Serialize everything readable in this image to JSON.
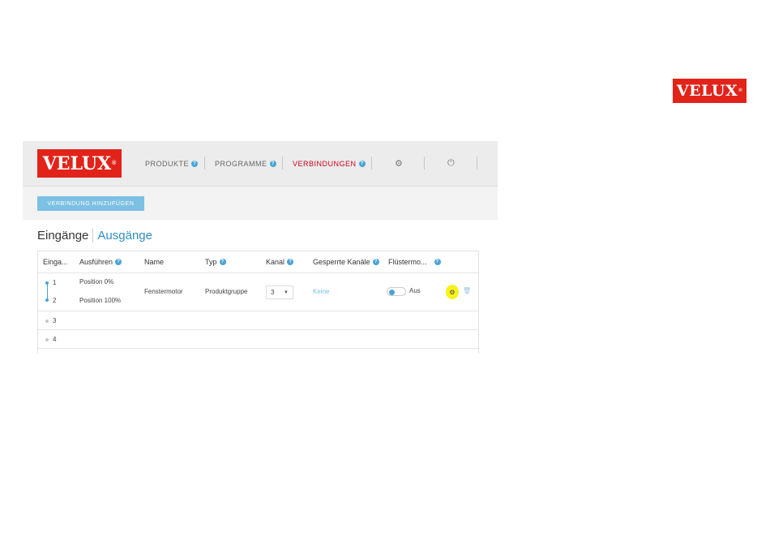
{
  "brand": {
    "logo_text": "VELUX",
    "logo_mark": "®",
    "color": "#e2231a"
  },
  "nav": {
    "items": [
      {
        "label": "PRODUKTE",
        "active": false
      },
      {
        "label": "PROGRAMME",
        "active": false
      },
      {
        "label": "VERBINDUNGEN",
        "active": true
      }
    ],
    "help_glyph": "?",
    "settings_icon": "gear-icon",
    "power_icon": "power-icon"
  },
  "toolbar": {
    "add_button_label": "VERBINDUNG HINZUFÜGEN"
  },
  "tabs": {
    "inputs_label": "Eingänge",
    "outputs_label": "Ausgänge"
  },
  "table": {
    "headers": [
      "Einga...",
      "Ausführen",
      "Name",
      "Typ",
      "Kanal",
      "Gesperrte Kanäle",
      "Flüstermo..."
    ],
    "row1": {
      "input_1": "1",
      "input_2": "2",
      "action_1": "Position 0%",
      "action_2": "Position 100%",
      "name": "Fenstermotor",
      "type": "Produktgruppe",
      "channel": "3",
      "blocked_channels": "Keine",
      "whisper_mode": "Aus"
    },
    "empty_rows": [
      "3",
      "4"
    ]
  },
  "colors": {
    "accent": "#4aa3d6",
    "active_nav": "#d0021b",
    "highlight": "#f7f21c"
  }
}
